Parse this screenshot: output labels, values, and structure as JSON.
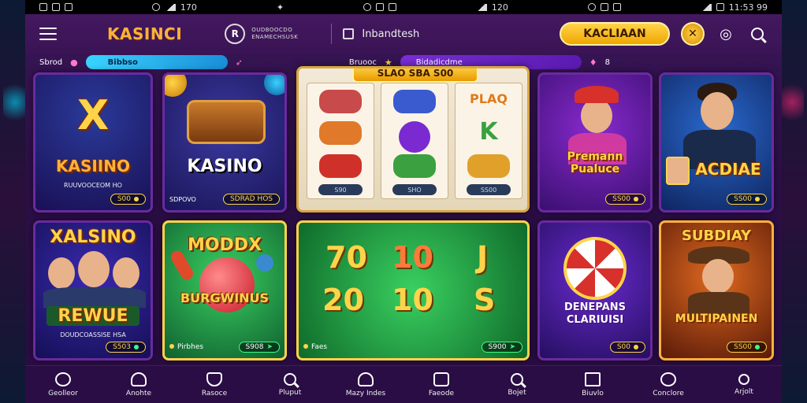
{
  "statusbar": {
    "left_time": "170",
    "mid_time": "120",
    "right_time": "11:53 99"
  },
  "header": {
    "brand": "KASINCI",
    "badge_line1": "OUDBOOCDO",
    "badge_line2": "ENAMECHSUSK",
    "badge_icon": "R",
    "search_label": "Inbandtesh",
    "cta_label": "KACLIAAN"
  },
  "subbar": {
    "left_label": "Sbrod",
    "cyan_pill": "Bibbso",
    "right_label": "Bruooc",
    "purple_pill": "Bidadicdme",
    "right_num": "8"
  },
  "cards": {
    "c1": {
      "title_letter": "X",
      "title": "KASIINO",
      "sub": "RUUVOOCEOM HO",
      "price": "S00"
    },
    "c2": {
      "title": "KASINO",
      "sub": "SDPOVO",
      "price": "SDRAD HOS"
    },
    "c3": {
      "header": "SLAO SBA S00",
      "reel1_price": "S90",
      "reel2_price": "SHO",
      "reel3_price": "SS00",
      "reel3_text1": "PLAQ",
      "reel3_text2": "K"
    },
    "c4": {
      "title": "Premann Pualuce",
      "price": "SS00"
    },
    "c5": {
      "title": "ACDIAE",
      "price": "SS00"
    },
    "c6": {
      "title": "XALSINO",
      "title2": "REWUE",
      "sub": "DOUDCOASSISE HSA",
      "price": "S503"
    },
    "c7": {
      "title": "MODDX",
      "title2": "BURGWINUS",
      "label": "Pirbhes",
      "price": "S908"
    },
    "c8": {
      "num1": "70",
      "num2": "10",
      "num3": "J",
      "num4": "20",
      "num5": "10",
      "num6": "S",
      "label": "Faes",
      "price": "S900"
    },
    "c9": {
      "title": "DENEPANS CLARIUISI",
      "price": "S00"
    },
    "c10": {
      "title": "SUBDIAY",
      "title2": "MULTIPAINEN",
      "price": "SS00"
    }
  },
  "bottom_nav": [
    {
      "label": "Geolleor",
      "icon": "b-circle-icon"
    },
    {
      "label": "Anohte",
      "icon": "home-icon"
    },
    {
      "label": "Rasoce",
      "icon": "shield-icon"
    },
    {
      "label": "Pluput",
      "icon": "search-icon"
    },
    {
      "label": "Mazy Indes",
      "icon": "home-icon"
    },
    {
      "label": "Faeode",
      "icon": "square-icon"
    },
    {
      "label": "Bojet",
      "icon": "search-icon"
    },
    {
      "label": "Biuvlo",
      "icon": "book-icon"
    },
    {
      "label": "Conclore",
      "icon": "heart-icon"
    },
    {
      "label": "Arjolt",
      "icon": "person-icon"
    }
  ],
  "colors": {
    "accent_gold": "#ffd44a",
    "bg_purple": "#3a1658",
    "pill_cyan": "#39d4ff",
    "pill_purple": "#7a2ed6"
  }
}
